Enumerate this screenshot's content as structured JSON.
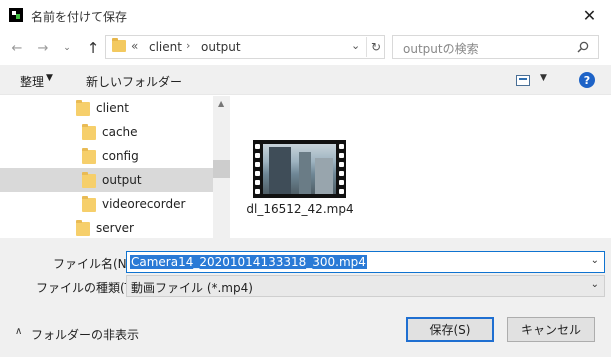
{
  "window": {
    "title": "名前を付けて保存",
    "close_glyph": "✕"
  },
  "nav": {
    "back_glyph": "←",
    "forward_glyph": "→",
    "history_glyph": "⌄",
    "up_glyph": "↑",
    "address": {
      "overflow": "«",
      "segments": [
        "client",
        "output"
      ],
      "separator": "›",
      "dropdown_glyph": "⌄",
      "refresh_glyph": "↻"
    },
    "search": {
      "placeholder": "outputの検索"
    }
  },
  "toolbar": {
    "organize_label": "整理",
    "organize_arrow": "▼",
    "new_folder_label": "新しいフォルダー",
    "view_arrow": "▼",
    "help_label": "?"
  },
  "tree": [
    {
      "label": "client",
      "indent": 1,
      "selected": false
    },
    {
      "label": "cache",
      "indent": 2,
      "selected": false
    },
    {
      "label": "config",
      "indent": 2,
      "selected": false
    },
    {
      "label": "output",
      "indent": 2,
      "selected": true
    },
    {
      "label": "videorecorder",
      "indent": 2,
      "selected": false
    },
    {
      "label": "server",
      "indent": 1,
      "selected": false
    }
  ],
  "files": [
    {
      "name": "dl_16512_42.mp4",
      "type": "video"
    }
  ],
  "form": {
    "filename_label": "ファイル名(N):",
    "filename_value": "Camera14_20201014133318_300.mp4",
    "filetype_label": "ファイルの種類(T):",
    "filetype_value": "動画ファイル (*.mp4)",
    "dropdown_glyph": "⌄"
  },
  "footer": {
    "hide_folders_arrow": "∧",
    "hide_folders_label": "フォルダーの非表示",
    "save_label": "保存(S)",
    "cancel_label": "キャンセル"
  }
}
